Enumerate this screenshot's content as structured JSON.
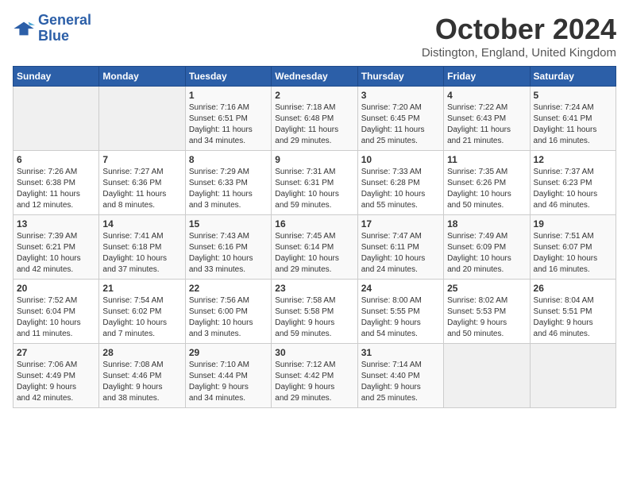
{
  "logo": {
    "line1": "General",
    "line2": "Blue"
  },
  "title": "October 2024",
  "subtitle": "Distington, England, United Kingdom",
  "days_header": [
    "Sunday",
    "Monday",
    "Tuesday",
    "Wednesday",
    "Thursday",
    "Friday",
    "Saturday"
  ],
  "weeks": [
    [
      {
        "day": "",
        "info": ""
      },
      {
        "day": "",
        "info": ""
      },
      {
        "day": "1",
        "info": "Sunrise: 7:16 AM\nSunset: 6:51 PM\nDaylight: 11 hours\nand 34 minutes."
      },
      {
        "day": "2",
        "info": "Sunrise: 7:18 AM\nSunset: 6:48 PM\nDaylight: 11 hours\nand 29 minutes."
      },
      {
        "day": "3",
        "info": "Sunrise: 7:20 AM\nSunset: 6:45 PM\nDaylight: 11 hours\nand 25 minutes."
      },
      {
        "day": "4",
        "info": "Sunrise: 7:22 AM\nSunset: 6:43 PM\nDaylight: 11 hours\nand 21 minutes."
      },
      {
        "day": "5",
        "info": "Sunrise: 7:24 AM\nSunset: 6:41 PM\nDaylight: 11 hours\nand 16 minutes."
      }
    ],
    [
      {
        "day": "6",
        "info": "Sunrise: 7:26 AM\nSunset: 6:38 PM\nDaylight: 11 hours\nand 12 minutes."
      },
      {
        "day": "7",
        "info": "Sunrise: 7:27 AM\nSunset: 6:36 PM\nDaylight: 11 hours\nand 8 minutes."
      },
      {
        "day": "8",
        "info": "Sunrise: 7:29 AM\nSunset: 6:33 PM\nDaylight: 11 hours\nand 3 minutes."
      },
      {
        "day": "9",
        "info": "Sunrise: 7:31 AM\nSunset: 6:31 PM\nDaylight: 10 hours\nand 59 minutes."
      },
      {
        "day": "10",
        "info": "Sunrise: 7:33 AM\nSunset: 6:28 PM\nDaylight: 10 hours\nand 55 minutes."
      },
      {
        "day": "11",
        "info": "Sunrise: 7:35 AM\nSunset: 6:26 PM\nDaylight: 10 hours\nand 50 minutes."
      },
      {
        "day": "12",
        "info": "Sunrise: 7:37 AM\nSunset: 6:23 PM\nDaylight: 10 hours\nand 46 minutes."
      }
    ],
    [
      {
        "day": "13",
        "info": "Sunrise: 7:39 AM\nSunset: 6:21 PM\nDaylight: 10 hours\nand 42 minutes."
      },
      {
        "day": "14",
        "info": "Sunrise: 7:41 AM\nSunset: 6:18 PM\nDaylight: 10 hours\nand 37 minutes."
      },
      {
        "day": "15",
        "info": "Sunrise: 7:43 AM\nSunset: 6:16 PM\nDaylight: 10 hours\nand 33 minutes."
      },
      {
        "day": "16",
        "info": "Sunrise: 7:45 AM\nSunset: 6:14 PM\nDaylight: 10 hours\nand 29 minutes."
      },
      {
        "day": "17",
        "info": "Sunrise: 7:47 AM\nSunset: 6:11 PM\nDaylight: 10 hours\nand 24 minutes."
      },
      {
        "day": "18",
        "info": "Sunrise: 7:49 AM\nSunset: 6:09 PM\nDaylight: 10 hours\nand 20 minutes."
      },
      {
        "day": "19",
        "info": "Sunrise: 7:51 AM\nSunset: 6:07 PM\nDaylight: 10 hours\nand 16 minutes."
      }
    ],
    [
      {
        "day": "20",
        "info": "Sunrise: 7:52 AM\nSunset: 6:04 PM\nDaylight: 10 hours\nand 11 minutes."
      },
      {
        "day": "21",
        "info": "Sunrise: 7:54 AM\nSunset: 6:02 PM\nDaylight: 10 hours\nand 7 minutes."
      },
      {
        "day": "22",
        "info": "Sunrise: 7:56 AM\nSunset: 6:00 PM\nDaylight: 10 hours\nand 3 minutes."
      },
      {
        "day": "23",
        "info": "Sunrise: 7:58 AM\nSunset: 5:58 PM\nDaylight: 9 hours\nand 59 minutes."
      },
      {
        "day": "24",
        "info": "Sunrise: 8:00 AM\nSunset: 5:55 PM\nDaylight: 9 hours\nand 54 minutes."
      },
      {
        "day": "25",
        "info": "Sunrise: 8:02 AM\nSunset: 5:53 PM\nDaylight: 9 hours\nand 50 minutes."
      },
      {
        "day": "26",
        "info": "Sunrise: 8:04 AM\nSunset: 5:51 PM\nDaylight: 9 hours\nand 46 minutes."
      }
    ],
    [
      {
        "day": "27",
        "info": "Sunrise: 7:06 AM\nSunset: 4:49 PM\nDaylight: 9 hours\nand 42 minutes."
      },
      {
        "day": "28",
        "info": "Sunrise: 7:08 AM\nSunset: 4:46 PM\nDaylight: 9 hours\nand 38 minutes."
      },
      {
        "day": "29",
        "info": "Sunrise: 7:10 AM\nSunset: 4:44 PM\nDaylight: 9 hours\nand 34 minutes."
      },
      {
        "day": "30",
        "info": "Sunrise: 7:12 AM\nSunset: 4:42 PM\nDaylight: 9 hours\nand 29 minutes."
      },
      {
        "day": "31",
        "info": "Sunrise: 7:14 AM\nSunset: 4:40 PM\nDaylight: 9 hours\nand 25 minutes."
      },
      {
        "day": "",
        "info": ""
      },
      {
        "day": "",
        "info": ""
      }
    ]
  ]
}
